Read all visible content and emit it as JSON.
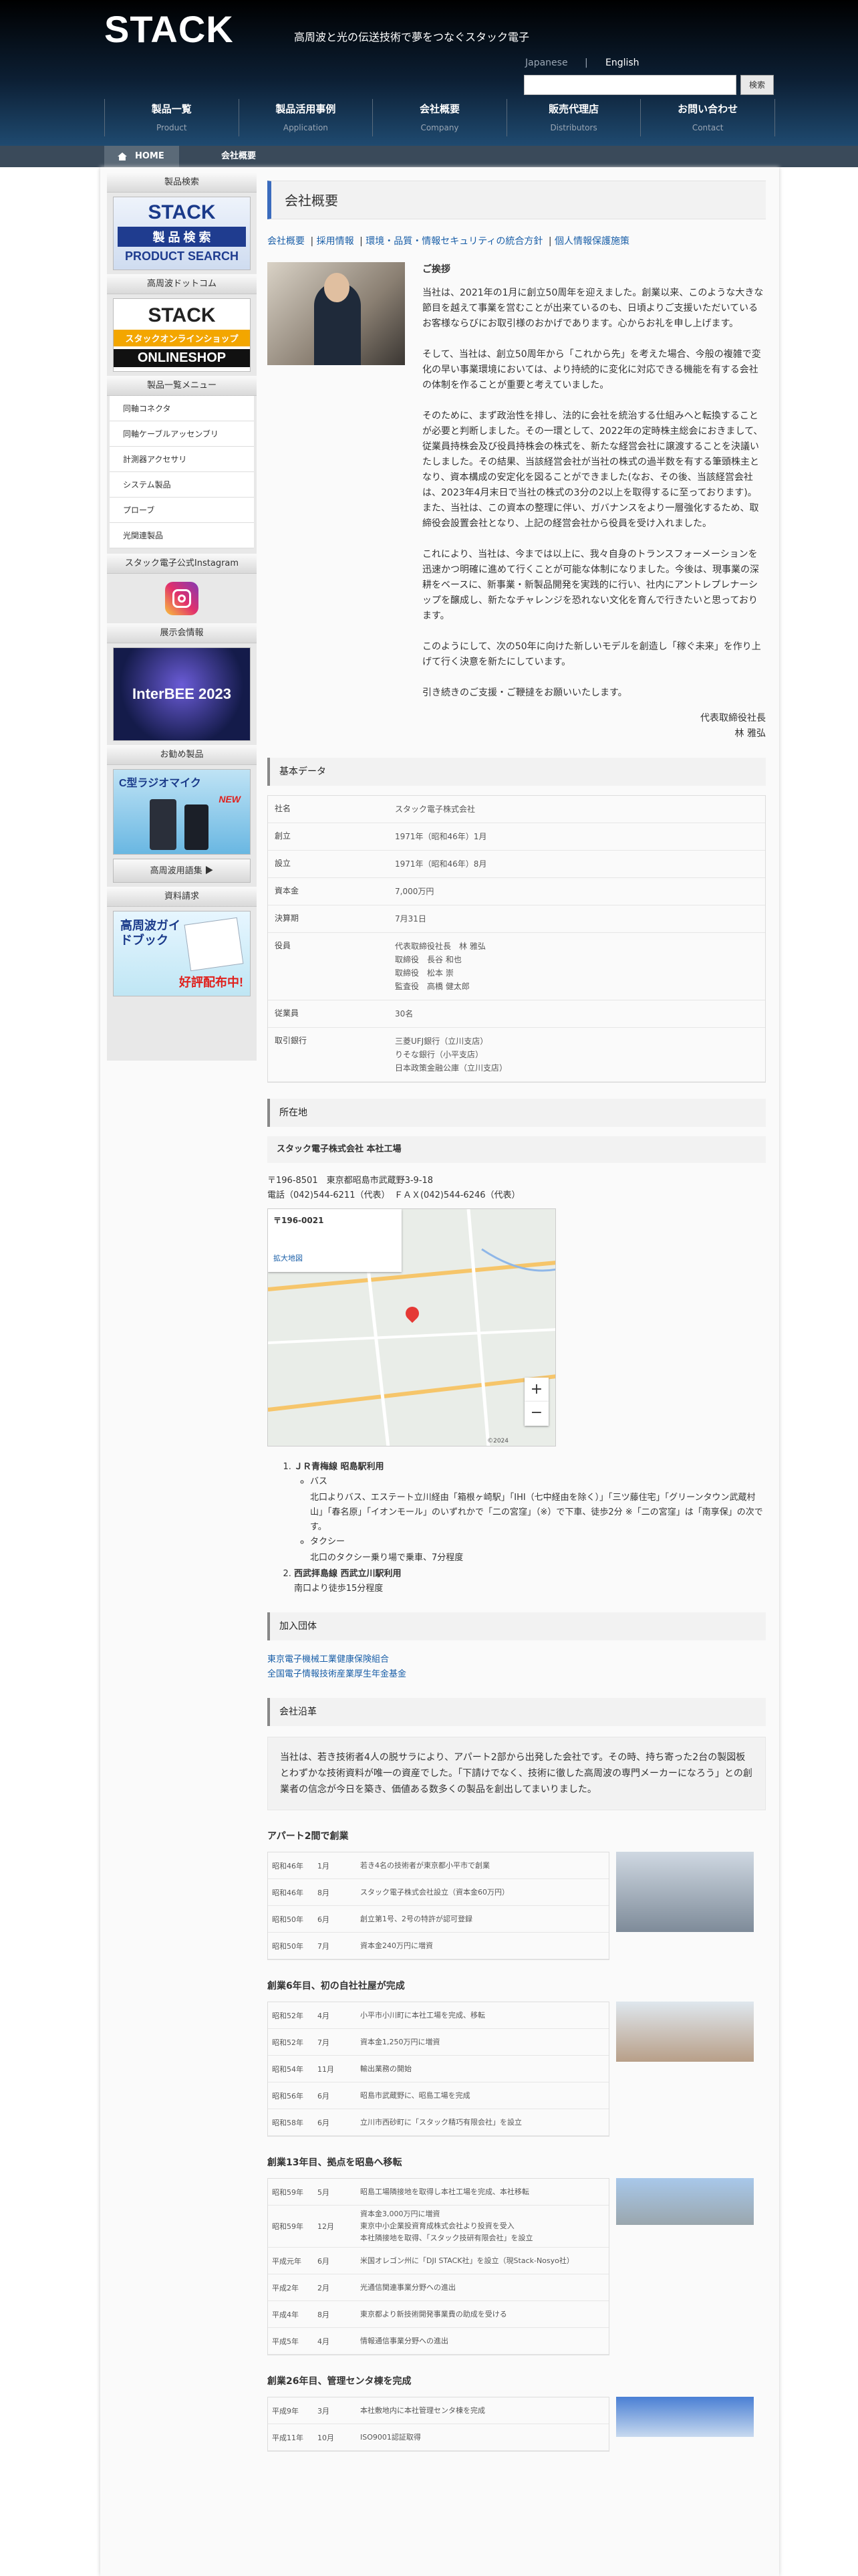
{
  "header": {
    "logo": "STACK",
    "tagline": "高周波と光の伝送技術で夢をつなぐスタック電子",
    "lang_ja": "Japanese",
    "lang_sep": "|",
    "lang_en": "English",
    "search_placeholder": "",
    "search_btn": "検索",
    "nav": [
      {
        "jp": "製品一覧",
        "en": "Product"
      },
      {
        "jp": "製品活用事例",
        "en": "Application"
      },
      {
        "jp": "会社概要",
        "en": "Company"
      },
      {
        "jp": "販売代理店",
        "en": "Distributors"
      },
      {
        "jp": "お問い合わせ",
        "en": "Contact"
      }
    ]
  },
  "breadcrumb": {
    "home": "HOME",
    "current": "会社概要"
  },
  "sidebar": {
    "search_head": "製品検索",
    "search_banner_top": "STACK",
    "search_banner_mid": "製 品 検 索",
    "search_banner_en": "PRODUCT SEARCH",
    "shop_head": "高周波ドットコム",
    "shop_banner_top": "STACK",
    "shop_banner_mid": "スタックオンラインショップ",
    "shop_banner_en": "ONLINESHOP",
    "menu_head": "製品一覧メニュー",
    "menu": [
      "同軸コネクタ",
      "同軸ケーブルアッセンブリ",
      "計測器アクセサリ",
      "システム製品",
      "プローブ",
      "光関連製品"
    ],
    "insta_head": "スタック電子公式Instagram",
    "expo_head": "展示会情報",
    "expo_banner": "InterBEE 2023",
    "rec_head": "お勧め製品",
    "rec_banner": "C型ラジオマイク",
    "rec_new": "NEW",
    "rec_link": "高周波用語集",
    "doc_head": "資料請求",
    "doc_banner": "高周波ガイドブック",
    "doc_banner_sub": "好評配布中!"
  },
  "main": {
    "title": "会社概要",
    "tabs": [
      "会社概要",
      "採用情報",
      "環境・品質・情報セキュリティの統合方針",
      "個人情報保護施策"
    ],
    "greeting_title": "ご挨拶",
    "greeting": [
      "当社は、2021年の1月に創立50周年を迎えました。創業以来、このような大きな節目を越えて事業を営むことが出来ているのも、日頃よりご支援いただいているお客様ならびにお取引様のおかげであります。心からお礼を申し上げます。",
      "そして、当社は、創立50周年から「これから先」を考えた場合、今般の複雑で変化の早い事業環境においては、より持続的に変化に対応できる機能を有する会社の体制を作ることが重要と考えていました。",
      "そのために、まず政治性を排し、法的に会社を統治する仕組みへと転換することが必要と判断しました。その一環として、2022年の定時株主総会におきまして、従業員持株会及び役員持株会の株式を、新たな経営会社に譲渡することを決議いたしました。その結果、当該経営会社が当社の株式の過半数を有する筆頭株主となり、資本構成の安定化を図ることができました(なお、その後、当該経営会社は、2023年4月末日で当社の株式の3分の2以上を取得するに至っております)。また、当社は、この資本の整理に伴い、ガバナンスをより一層強化するため、取締役会設置会社となり、上記の経営会社から役員を受け入れました。",
      "これにより、当社は、今までは以上に、我々自身のトランスフォーメーションを迅速かつ明確に進めて行くことが可能な体制になりました。今後は、現事業の深耕をベースに、新事業・新製品開発を実践的に行い、社内にアントレプレナーシップを醸成し、新たなチャレンジを恐れない文化を育んで行きたいと思っております。",
      "このようにして、次の50年に向けた新しいモデルを創造し「稼ぐ未来」を作り上げて行く決意を新たにしています。",
      "引き続きのご支援・ご鞭撻をお願いいたします。"
    ],
    "sign_title": "代表取締役社長",
    "sign_name": "林 雅弘",
    "basic_title": "基本データ",
    "basic": [
      {
        "k": "社名",
        "v": "スタック電子株式会社"
      },
      {
        "k": "創立",
        "v": "1971年（昭和46年）1月"
      },
      {
        "k": "設立",
        "v": "1971年（昭和46年）8月"
      },
      {
        "k": "資本金",
        "v": "7,000万円"
      },
      {
        "k": "決算期",
        "v": "7月31日"
      },
      {
        "k": "役員",
        "v": "代表取締役社長　林 雅弘\n取締役　長谷 和也\n取締役　松本 崇\n監査役　高橋 健太郎"
      },
      {
        "k": "従業員",
        "v": "30名"
      },
      {
        "k": "取引銀行",
        "v": "三菱UFJ銀行（立川支店）\nりそな銀行（小平支店）\n日本政策金融公庫（立川支店）"
      }
    ],
    "location_title": "所在地",
    "office_name": "スタック電子株式会社 本社工場",
    "address": "〒196-8501　東京都昭島市武蔵野3-9-18",
    "tel": "電話（042)544-6211（代表）　ＦＡＸ(042)544-6246（代表）",
    "map_label": "〒196-0021",
    "map_zoom": "拡大地図",
    "map_copyright": "©2024",
    "routes": [
      {
        "head": "ＪＲ青梅線 昭島駅利用",
        "items": [
          "バス",
          "北口よりバス、エステート立川経由「箱根ヶ崎駅」「IHI（七中経由を除く）」「三ツ藤住宅」「グリーンタウン武蔵村山」「春名原」「イオンモール」のいずれかで「二の宮窪」（※）で下車、徒歩2分 ※「二の宮窪」は「南享保」の次です。",
          "タクシー",
          "北口のタクシー乗り場で乗車、7分程度"
        ]
      },
      {
        "head": "西武拝島線 西武立川駅利用",
        "items": [
          "南口より徒歩15分程度"
        ]
      }
    ],
    "org_title": "加入団体",
    "orgs": [
      "東京電子機械工業健康保険組合",
      "全国電子情報技術産業厚生年金基金"
    ],
    "history_title": "会社沿革",
    "history_intro": "当社は、若き技術者4人の脱サラにより、アパート2部から出発した会社です。その時、持ち寄った2台の製図板とわずかな技術資料が唯一の資産でした。「下請けでなく、技術に徹した高周波の専門メーカーになろう」との創業者の信念が今日を築き、価値ある数多くの製品を創出してまいりました。",
    "eras": [
      {
        "title": "アパート2間で創業",
        "rows": [
          [
            "昭和46年",
            "1月",
            "若き4名の技術者が東京都小平市で創業"
          ],
          [
            "昭和46年",
            "8月",
            "スタック電子株式会社設立（資本金60万円）"
          ],
          [
            "昭和50年",
            "6月",
            "創立第1号、2号の特許が認可登録"
          ],
          [
            "昭和50年",
            "7月",
            "資本金240万円に増資"
          ]
        ]
      },
      {
        "title": "創業6年目、初の自社社屋が完成",
        "rows": [
          [
            "昭和52年",
            "4月",
            "小平市小川町に本社工場を完成、移転"
          ],
          [
            "昭和52年",
            "7月",
            "資本金1,250万円に増資"
          ],
          [
            "昭和54年",
            "11月",
            "輸出業務の開始"
          ],
          [
            "昭和56年",
            "6月",
            "昭島市武蔵野に、昭島工場を完成"
          ],
          [
            "昭和58年",
            "6月",
            "立川市西砂町に「スタック精巧有限会社」を設立"
          ]
        ]
      },
      {
        "title": "創業13年目、拠点を昭島へ移転",
        "rows": [
          [
            "昭和59年",
            "5月",
            "昭島工場隣接地を取得し本社工場を完成、本社移転"
          ],
          [
            "昭和59年",
            "12月",
            "資本金3,000万円に増資\n東京中小企業投資育成株式会社より投資を受入\n本社隣接地を取得、「スタック技研有限会社」を設立"
          ],
          [
            "平成元年",
            "6月",
            "米国オレゴン州に「DJI STACK社」を設立（現Stack-Nosyo社）"
          ],
          [
            "平成2年",
            "2月",
            "光通信関連事業分野への進出"
          ],
          [
            "平成4年",
            "8月",
            "東京都より新技術開発事業費の助成を受ける"
          ],
          [
            "平成5年",
            "4月",
            "情報通信事業分野への進出"
          ]
        ]
      },
      {
        "title": "創業26年目、管理センタ棟を完成",
        "rows": [
          [
            "平成9年",
            "3月",
            "本社敷地内に本社管理センタ棟を完成"
          ],
          [
            "平成11年",
            "10月",
            "ISO9001認証取得"
          ]
        ]
      }
    ]
  }
}
